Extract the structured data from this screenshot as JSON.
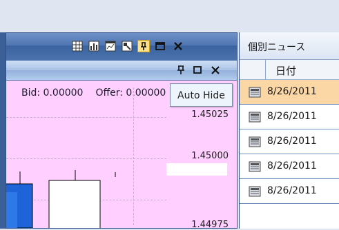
{
  "chart_window": {
    "toolbar_icons": [
      "grid-icon",
      "bar-chart-icon",
      "chart-window-icon",
      "tile-icon",
      "pin-icon",
      "maximize-icon",
      "close-icon"
    ],
    "subbar_icons": [
      "pin-icon",
      "maximize-icon",
      "close-icon"
    ],
    "bid_label": "Bid: 0.00000",
    "offer_label": "Offer: 0.00000",
    "price_levels": [
      "1.45025",
      "1.45000",
      "1.44975"
    ],
    "background_color": "#ffd0ff"
  },
  "tooltip": {
    "text": "Auto Hide"
  },
  "news_window": {
    "title": "個別ニュース",
    "column_date": "日付",
    "rows": [
      {
        "date": "8/26/2011",
        "selected": true
      },
      {
        "date": "8/26/2011",
        "selected": false
      },
      {
        "date": "8/26/2011",
        "selected": false
      },
      {
        "date": "8/26/2011",
        "selected": false
      },
      {
        "date": "8/26/2011",
        "selected": false
      }
    ]
  }
}
